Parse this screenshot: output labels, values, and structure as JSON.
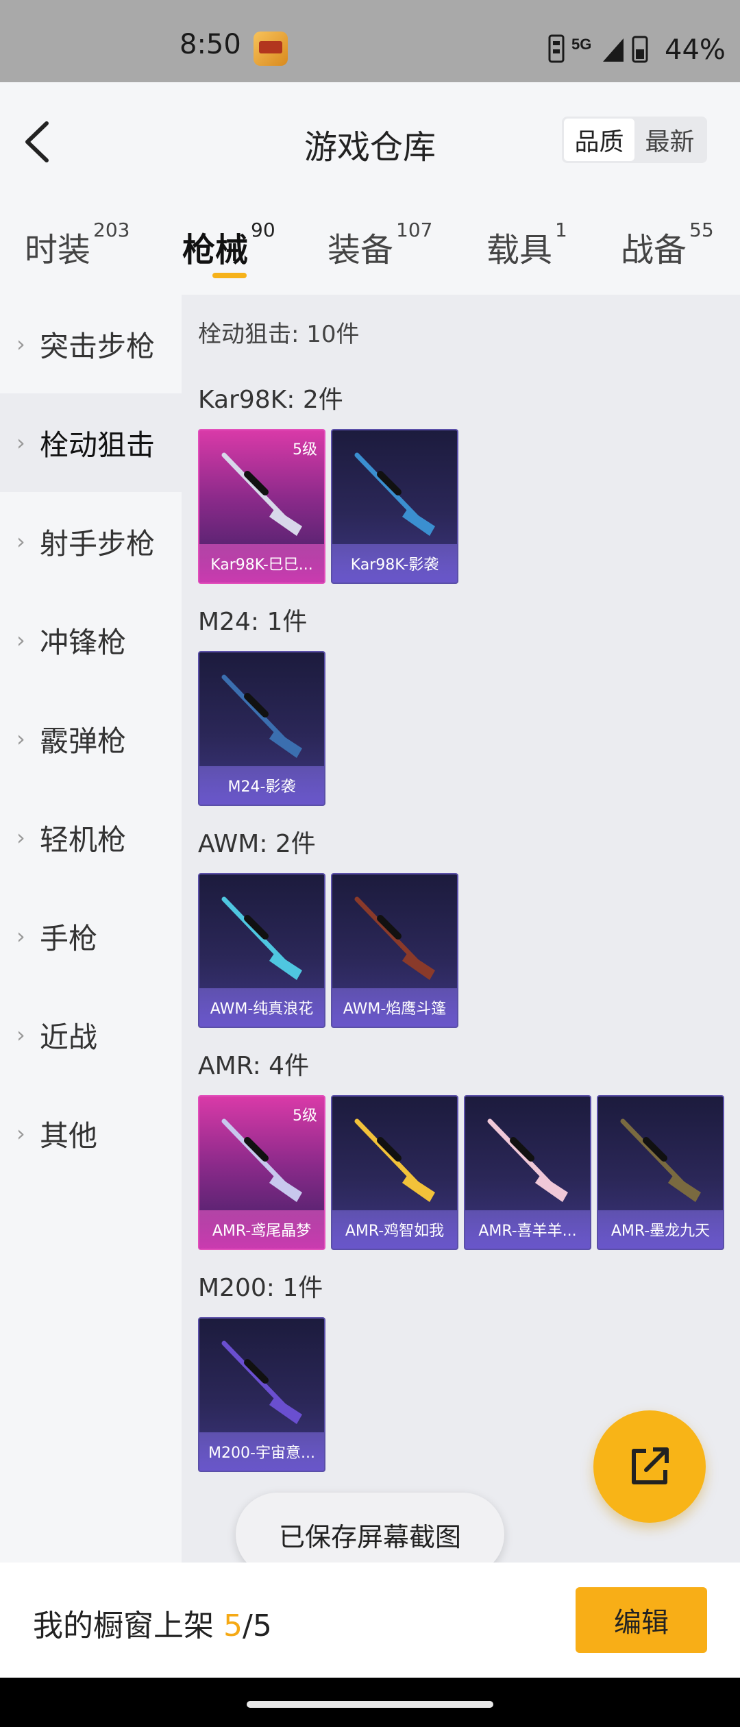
{
  "status_bar": {
    "time": "8:50",
    "network": "5G",
    "battery": "44%"
  },
  "header": {
    "title": "游戏仓库",
    "sort_options": [
      "品质",
      "最新"
    ],
    "sort_active": "品质"
  },
  "tabs": [
    {
      "label": "时装",
      "count": "203"
    },
    {
      "label": "枪械",
      "count": "90",
      "active": true
    },
    {
      "label": "装备",
      "count": "107"
    },
    {
      "label": "载具",
      "count": "1"
    },
    {
      "label": "战备",
      "count": "55"
    }
  ],
  "sidebar": [
    {
      "label": "突击步枪"
    },
    {
      "label": "栓动狙击",
      "active": true
    },
    {
      "label": "射手步枪"
    },
    {
      "label": "冲锋枪"
    },
    {
      "label": "霰弹枪"
    },
    {
      "label": "轻机枪"
    },
    {
      "label": "手枪"
    },
    {
      "label": "近战"
    },
    {
      "label": "其他"
    }
  ],
  "main": {
    "summary": "栓动狙击: 10件",
    "groups": [
      {
        "title": "Kar98K: 2件",
        "items": [
          {
            "name": "Kar98K-巳巳...",
            "level": "5级",
            "quality": "gold",
            "gun_color": "#d8d8ea"
          },
          {
            "name": "Kar98K-影袭",
            "quality": "purple",
            "gun_color": "#3b8fd0"
          }
        ]
      },
      {
        "title": "M24: 1件",
        "items": [
          {
            "name": "M24-影袭",
            "quality": "purple",
            "gun_color": "#3b6fb0"
          }
        ]
      },
      {
        "title": "AWM: 2件",
        "items": [
          {
            "name": "AWM-纯真浪花",
            "quality": "purple",
            "gun_color": "#4fc6e0"
          },
          {
            "name": "AWM-焰鹰斗篷",
            "quality": "purple",
            "gun_color": "#8a3a2a"
          }
        ]
      },
      {
        "title": "AMR: 4件",
        "items": [
          {
            "name": "AMR-鸢尾晶梦",
            "level": "5级",
            "quality": "gold",
            "gun_color": "#c8c8ee"
          },
          {
            "name": "AMR-鸡智如我",
            "quality": "purple",
            "gun_color": "#f2c23a"
          },
          {
            "name": "AMR-喜羊羊...",
            "quality": "purple",
            "gun_color": "#f0c8d8"
          },
          {
            "name": "AMR-墨龙九天",
            "quality": "purple",
            "gun_color": "#7a6a40"
          }
        ]
      },
      {
        "title": "M200: 1件",
        "items": [
          {
            "name": "M200-宇宙意...",
            "quality": "purple",
            "gun_color": "#6a4fd0"
          }
        ]
      }
    ]
  },
  "toast": "已保存屏幕截图",
  "bottom_bar": {
    "shelf_label": "我的橱窗上架 ",
    "shelf_current": "5",
    "shelf_total": "/5",
    "edit_label": "编辑"
  },
  "colors": {
    "accent": "#f8ae17",
    "gold_card": "#d93aa8",
    "purple_card": "#2b2758"
  },
  "icons": {
    "back": "chevron-left-icon",
    "share": "share-external-icon"
  }
}
